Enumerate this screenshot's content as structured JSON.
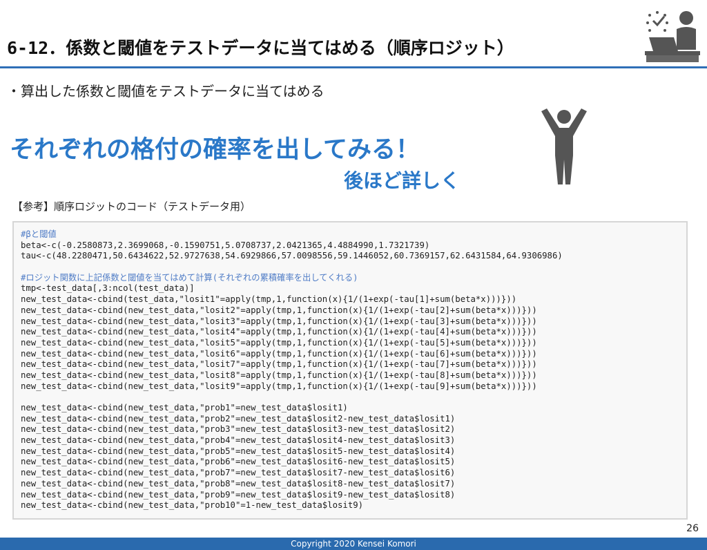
{
  "slide": {
    "title": "6-12．係数と閾値をテストデータに当てはめる（順序ロジット）",
    "bullet": "・算出した係数と閾値をテストデータに当てはめる",
    "headline": "それぞれの格付の確率を出してみる！",
    "subline": "後ほど詳しく",
    "ref_label": "【参考】順序ロジットのコード（テストデータ用）",
    "page_number": "26",
    "footer": "Copyright 2020 Kensei Komori"
  },
  "code": {
    "lines": [
      {
        "text": "#βと閾値",
        "kind": "comment"
      },
      {
        "text": "beta<-c(-0.2580873,2.3699068,-0.1590751,5.0708737,2.0421365,4.4884990,1.7321739)",
        "kind": "code"
      },
      {
        "text": "tau<-c(48.2280471,50.6434622,52.9727638,54.6929866,57.0098556,59.1446052,60.7369157,62.6431584,64.9306986)",
        "kind": "code"
      },
      {
        "text": "",
        "kind": "blank"
      },
      {
        "text": "#ロジット関数に上記係数と閾値を当てはめて計算(それぞれの累積確率を出してくれる)",
        "kind": "comment"
      },
      {
        "text": "tmp<-test_data[,3:ncol(test_data)]",
        "kind": "code"
      },
      {
        "text": "new_test_data<-cbind(test_data,\"losit1\"=apply(tmp,1,function(x){1/(1+exp(-tau[1]+sum(beta*x)))}))",
        "kind": "code"
      },
      {
        "text": "new_test_data<-cbind(new_test_data,\"losit2\"=apply(tmp,1,function(x){1/(1+exp(-tau[2]+sum(beta*x)))}))",
        "kind": "code"
      },
      {
        "text": "new_test_data<-cbind(new_test_data,\"losit3\"=apply(tmp,1,function(x){1/(1+exp(-tau[3]+sum(beta*x)))}))",
        "kind": "code"
      },
      {
        "text": "new_test_data<-cbind(new_test_data,\"losit4\"=apply(tmp,1,function(x){1/(1+exp(-tau[4]+sum(beta*x)))}))",
        "kind": "code"
      },
      {
        "text": "new_test_data<-cbind(new_test_data,\"losit5\"=apply(tmp,1,function(x){1/(1+exp(-tau[5]+sum(beta*x)))}))",
        "kind": "code"
      },
      {
        "text": "new_test_data<-cbind(new_test_data,\"losit6\"=apply(tmp,1,function(x){1/(1+exp(-tau[6]+sum(beta*x)))}))",
        "kind": "code"
      },
      {
        "text": "new_test_data<-cbind(new_test_data,\"losit7\"=apply(tmp,1,function(x){1/(1+exp(-tau[7]+sum(beta*x)))}))",
        "kind": "code"
      },
      {
        "text": "new_test_data<-cbind(new_test_data,\"losit8\"=apply(tmp,1,function(x){1/(1+exp(-tau[8]+sum(beta*x)))}))",
        "kind": "code"
      },
      {
        "text": "new_test_data<-cbind(new_test_data,\"losit9\"=apply(tmp,1,function(x){1/(1+exp(-tau[9]+sum(beta*x)))}))",
        "kind": "code"
      },
      {
        "text": "",
        "kind": "blank"
      },
      {
        "text": "new_test_data<-cbind(new_test_data,\"prob1\"=new_test_data$losit1)",
        "kind": "code"
      },
      {
        "text": "new_test_data<-cbind(new_test_data,\"prob2\"=new_test_data$losit2-new_test_data$losit1)",
        "kind": "code"
      },
      {
        "text": "new_test_data<-cbind(new_test_data,\"prob3\"=new_test_data$losit3-new_test_data$losit2)",
        "kind": "code"
      },
      {
        "text": "new_test_data<-cbind(new_test_data,\"prob4\"=new_test_data$losit4-new_test_data$losit3)",
        "kind": "code"
      },
      {
        "text": "new_test_data<-cbind(new_test_data,\"prob5\"=new_test_data$losit5-new_test_data$losit4)",
        "kind": "code"
      },
      {
        "text": "new_test_data<-cbind(new_test_data,\"prob6\"=new_test_data$losit6-new_test_data$losit5)",
        "kind": "code"
      },
      {
        "text": "new_test_data<-cbind(new_test_data,\"prob7\"=new_test_data$losit7-new_test_data$losit6)",
        "kind": "code"
      },
      {
        "text": "new_test_data<-cbind(new_test_data,\"prob8\"=new_test_data$losit8-new_test_data$losit7)",
        "kind": "code"
      },
      {
        "text": "new_test_data<-cbind(new_test_data,\"prob9\"=new_test_data$losit9-new_test_data$losit8)",
        "kind": "code"
      },
      {
        "text": "new_test_data<-cbind(new_test_data,\"prob10\"=1-new_test_data$losit9)",
        "kind": "code"
      }
    ]
  },
  "icons": {
    "header": "presenter-at-desk-with-clock-icon",
    "person": "person-arms-raised-icon"
  },
  "colors": {
    "accent": "#2a78c8",
    "rule": "#2f6fb7",
    "footer_bg": "#2a6aae",
    "comment": "#4f7cc6",
    "icon": "#555555"
  }
}
